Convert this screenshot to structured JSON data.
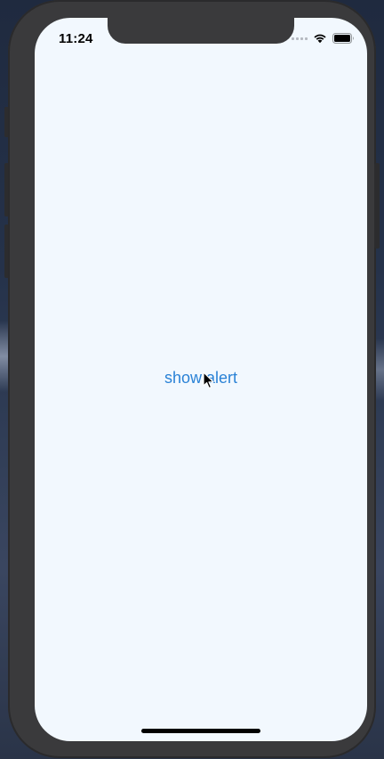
{
  "status_bar": {
    "time": "11:24",
    "signal_icon": "cellular-signal-empty-icon",
    "wifi_icon": "wifi-icon",
    "battery_icon": "battery-full-icon"
  },
  "main": {
    "show_alert_label": "show alert"
  },
  "pointer": {
    "icon": "mouse-cursor-icon"
  },
  "colors": {
    "screen_background": "#f2f8fe",
    "link_blue": "#2a82d6",
    "device_frame": "#3a3a3c"
  }
}
